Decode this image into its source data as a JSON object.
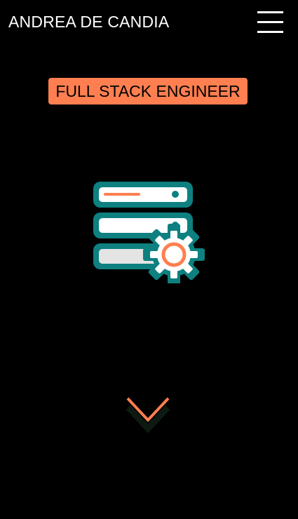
{
  "header": {
    "title": "ANDREA DE CANDIA",
    "menu_icon": "hamburger-menu-icon"
  },
  "hero": {
    "role": "FULL STACK ENGINEER",
    "illustration_icon": "server-gear-icon"
  },
  "scroll": {
    "icon": "chevron-down-icon"
  },
  "colors": {
    "background": "#000000",
    "accent": "#ff7f50",
    "teal": "#0e8080",
    "text": "#ffffff"
  }
}
